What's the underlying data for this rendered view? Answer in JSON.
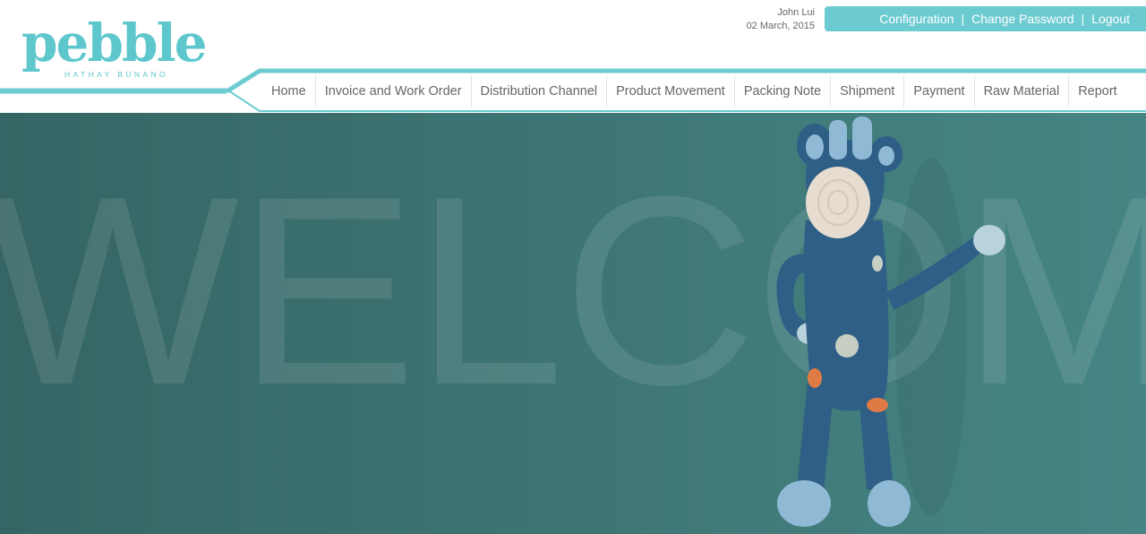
{
  "brand": {
    "name": "pebble",
    "tagline": "HATHAY BUNANO"
  },
  "user": {
    "name": "John Lui",
    "date": "02 March, 2015"
  },
  "top_links": [
    {
      "label": "Configuration"
    },
    {
      "label": "Change Password"
    },
    {
      "label": "Logout"
    }
  ],
  "nav": [
    {
      "label": "Home"
    },
    {
      "label": "Invoice and Work Order"
    },
    {
      "label": "Distribution Channel"
    },
    {
      "label": "Product Movement"
    },
    {
      "label": "Packing Note"
    },
    {
      "label": "Shipment"
    },
    {
      "label": "Payment"
    },
    {
      "label": "Raw Material"
    },
    {
      "label": "Report"
    }
  ],
  "hero": {
    "watermark": "WELCOME"
  },
  "colors": {
    "brand": "#5ec7cd",
    "accent": "#6ccbd1",
    "hero_bg": "#3d7473"
  },
  "icons": {
    "hero_image": "crochet-giraffe-toy-icon"
  }
}
